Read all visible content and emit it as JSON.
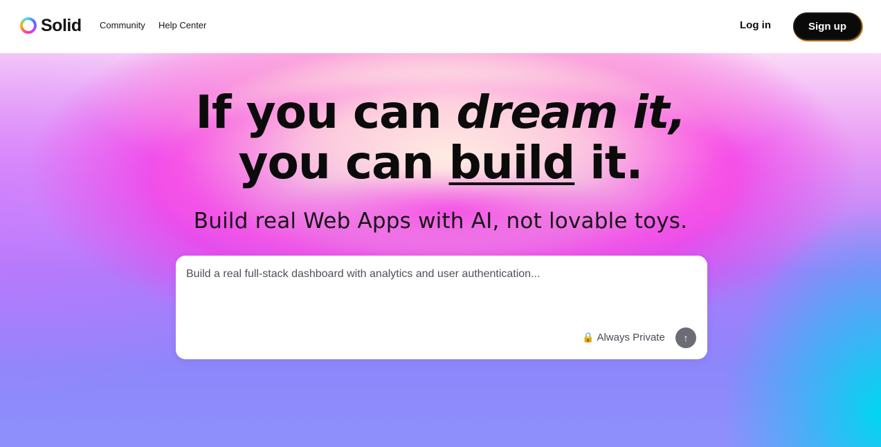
{
  "header": {
    "logo_text": "Solid",
    "nav": [
      {
        "label": "Community"
      },
      {
        "label": "Help Center"
      }
    ],
    "login_label": "Log in",
    "signup_label": "Sign up"
  },
  "hero": {
    "headline": {
      "line1_plain": "If you can ",
      "line1_italic": "dream it,",
      "line2_plain": "you can ",
      "line2_underline": "build",
      "line2_end": " it."
    },
    "subheadline": "Build real Web Apps with AI, not lovable toys.",
    "prompt": {
      "placeholder": "Build a real full-stack dashboard with analytics and user authentication...",
      "value": "",
      "private_label": "Always Private",
      "lock_icon": "lock-icon",
      "send_icon": "arrow-up-icon"
    }
  },
  "colors": {
    "signup_bg": "#0a0a0a",
    "send_button_bg": "#6c6c76",
    "gradient_pink": "#f03ce6",
    "gradient_cyan": "#00d6f0",
    "gradient_violet": "#8d87fb"
  }
}
